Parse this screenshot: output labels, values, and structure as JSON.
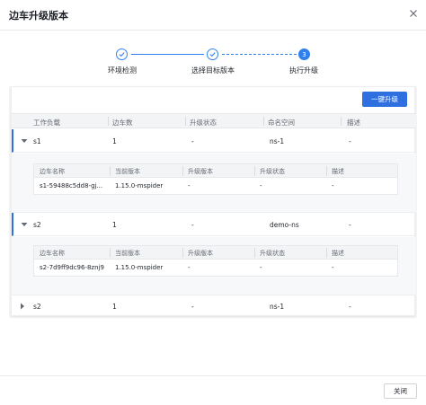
{
  "dialog": {
    "title": "边车升级版本",
    "close_icon": "close-icon"
  },
  "steps": [
    {
      "label": "环境检测",
      "state": "done"
    },
    {
      "label": "选择目标版本",
      "state": "done"
    },
    {
      "label": "执行升级",
      "state": "active",
      "number": "3"
    }
  ],
  "toolbar": {
    "upgrade_all_label": "一键升级"
  },
  "table": {
    "columns": [
      "工作负载",
      "边车数",
      "升级状态",
      "命名空间",
      "描述"
    ],
    "rows": [
      {
        "workload": "s1",
        "sidecar_count": "1",
        "upgrade_status": "-",
        "namespace": "ns-1",
        "description": "-",
        "expanded": true,
        "sub_columns": [
          "边车名称",
          "当前版本",
          "升级版本",
          "升级状态",
          "描述"
        ],
        "sub_rows": [
          {
            "name": "s1-59488c5dd8-gj...",
            "current_version": "1.15.0-mspider",
            "upgrade_version": "-",
            "status": "-",
            "description": "-"
          }
        ]
      },
      {
        "workload": "s2",
        "sidecar_count": "1",
        "upgrade_status": "-",
        "namespace": "demo-ns",
        "description": "-",
        "expanded": true,
        "sub_columns": [
          "边车名称",
          "当前版本",
          "升级版本",
          "升级状态",
          "描述"
        ],
        "sub_rows": [
          {
            "name": "s2-7d9ff9dc96-8znj9",
            "current_version": "1.15.0-mspider",
            "upgrade_version": "-",
            "status": "-",
            "description": "-"
          }
        ]
      },
      {
        "workload": "s2",
        "sidecar_count": "1",
        "upgrade_status": "-",
        "namespace": "ns-1",
        "description": "-",
        "expanded": false
      }
    ]
  },
  "footer": {
    "close_label": "关闭"
  },
  "colors": {
    "primary": "#2f6fe0",
    "step_blue": "#2f80ed"
  }
}
